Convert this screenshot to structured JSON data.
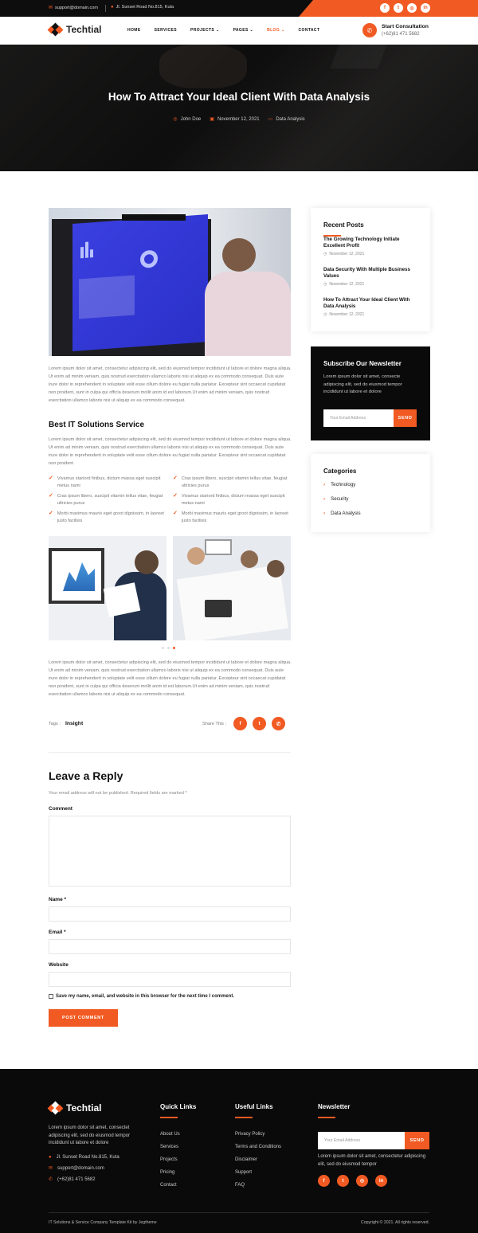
{
  "topbar": {
    "email": "support@domain.com",
    "address": "Jl. Sunset Road No.815, Kuta",
    "socials": [
      "f",
      "t",
      "ig",
      "in"
    ]
  },
  "nav": {
    "logo": "Techtial",
    "items": [
      "HOME",
      "SERVICES",
      "PROJECTS",
      "PAGES",
      "BLOG",
      "CONTACT"
    ],
    "active": "BLOG",
    "consult_label": "Start Consultation",
    "consult_phone": "(+62)81 471 5682"
  },
  "hero": {
    "title": "How To Attract Your Ideal Client With Data Analysis",
    "author": "John Doe",
    "date": "November 12, 2021",
    "category": "Data Analysis"
  },
  "article": {
    "para1": "Lorem ipsum dolor sit amet, consectetur adipiscing elit, sed do eiusmod tempor incididunt ut labore et dolore magna aliqua. Ut enim ad minim veniam, quis nostrud exercitation ullamco laboris nisi ut aliquip ex ea commodo consequat. Duis aute irure dolor in reprehenderit in voluptate velit esse cillum dolore eu fugiat nulla pariatur. Excepteur sint occaecat cupidatat non proident, sunt in culpa qui officia deserunt mollit anim id est laborum.Ut enim ad minim veniam, quis nostrud exercitation ullamco laboris nisi ut aliquip ex ea commodo consequat.",
    "heading": "Best IT Solutions Service",
    "para2": "Lorem ipsum dolor sit amet, consectetur adipiscing elit, sed do eiusmod tempor incididunt ut labore et dolore magna aliqua. Ut enim ad minim veniam, quis nostrud exercitation ullamco laboris nisi ut aliquip ex ea commodo consequat. Duis aute irure dolor in reprehenderit in voluptate velit esse cillum dolore eu fugiat nulla pariatur. Excepteur sint occaecat cupidatat non proident",
    "checks_left": [
      "Vivamus stariord finibus, dictum massa eget suscipit metus nami",
      "Cras ipsum libero, suscipit vitamin tellus vitae, feugiat ultricies purus",
      "Morbi maximus mauris eget groot dignissim, in laoreet justo facilisis"
    ],
    "checks_right": [
      "Cras ipsum libero, suscipit vitamin tellus vitae, feugiat ultricies purus",
      "Vivamus stariord finibus, dictum massa eget suscipit metus nami",
      "Morbi maximus mauris eget groot dignissim, in laoreet justo facilisis"
    ],
    "para3": "Lorem ipsum dolor sit amet, consectetur adipiscing elit, sed do eiusmod tempor incididunt ut labore et dolore magna aliqua. Ut enim ad minim veniam, quis nostrud exercitation ullamco laboris nisi ut aliquip ex ea commodo consequat. Duis aute irure dolor in reprehenderit in voluptate velit esse cillum dolore eu fugiat nulla pariatur. Excepteur sint occaecat cupidatat non proident, sunt in culpa qui officia deserunt mollit anim id est laborum.Ut enim ad minim veniam, quis nostrud exercitation ullamco laboris nisi ut aliquip ex ea commodo consequat.",
    "tags_label": "Tags :",
    "tag": "Insight",
    "share_label": "Share This :"
  },
  "reply": {
    "title": "Leave a Reply",
    "note": "Your email address will not be published. Required fields are marked *",
    "comment_label": "Comment",
    "name_label": "Name *",
    "email_label": "Email *",
    "website_label": "Website",
    "checkbox_label": "Save my name, email, and website in this browser for the next time I comment.",
    "submit": "POST COMMENT"
  },
  "sidebar": {
    "recent_title": "Recent Posts",
    "recent_posts": [
      {
        "title": "The Growing Technology Initiate Excellent Profit",
        "date": "November 12, 2021"
      },
      {
        "title": "Data Security With Multiple Business Values",
        "date": "November 12, 2021"
      },
      {
        "title": "How To Attract Your Ideal Client With Data Analysis",
        "date": "November 12, 2021"
      }
    ],
    "newsletter_title": "Subscribe Our Newsletter",
    "newsletter_text": "Lorem ipsum dolor sit amet, consecte adipiscing elit, sed do eiusmod tempor incididunt ut labore et dolore",
    "newsletter_placeholder": "Your Email Address",
    "newsletter_button": "SEND",
    "categories_title": "Categories",
    "categories": [
      "Technology",
      "Security",
      "Data Analysis"
    ]
  },
  "footer": {
    "logo": "Techtial",
    "about": "Lorem ipsum dolor sit amet, consectet adipiscing elit, sed do eiusmod tempor incididunt ut labore et dolore",
    "address": "Jl. Sunset Road No.815, Kuta",
    "email": "support@domain.com",
    "phone": "(+62)81 471 5682",
    "quick_title": "Quick Links",
    "quick_links": [
      "About Us",
      "Services",
      "Projects",
      "Pricing",
      "Contact"
    ],
    "useful_title": "Useful Links",
    "useful_links": [
      "Privacy Policy",
      "Terms and Conditions",
      "Disclaimer",
      "Support",
      "FAQ"
    ],
    "newsletter_title": "Newsletter",
    "newsletter_placeholder": "Your Email Address",
    "newsletter_button": "SEND",
    "newsletter_text": "Lorem ipsum dolor sit amet, consectetur adipiscing elit, sed do eiusmod tempor",
    "credit": "IT Solutions & Service Company Template Kit by Jegtheme",
    "copyright": "Copyright © 2021. All rights reserved."
  },
  "colors": {
    "accent": "#f15a22",
    "dark": "#0d0d0d"
  }
}
